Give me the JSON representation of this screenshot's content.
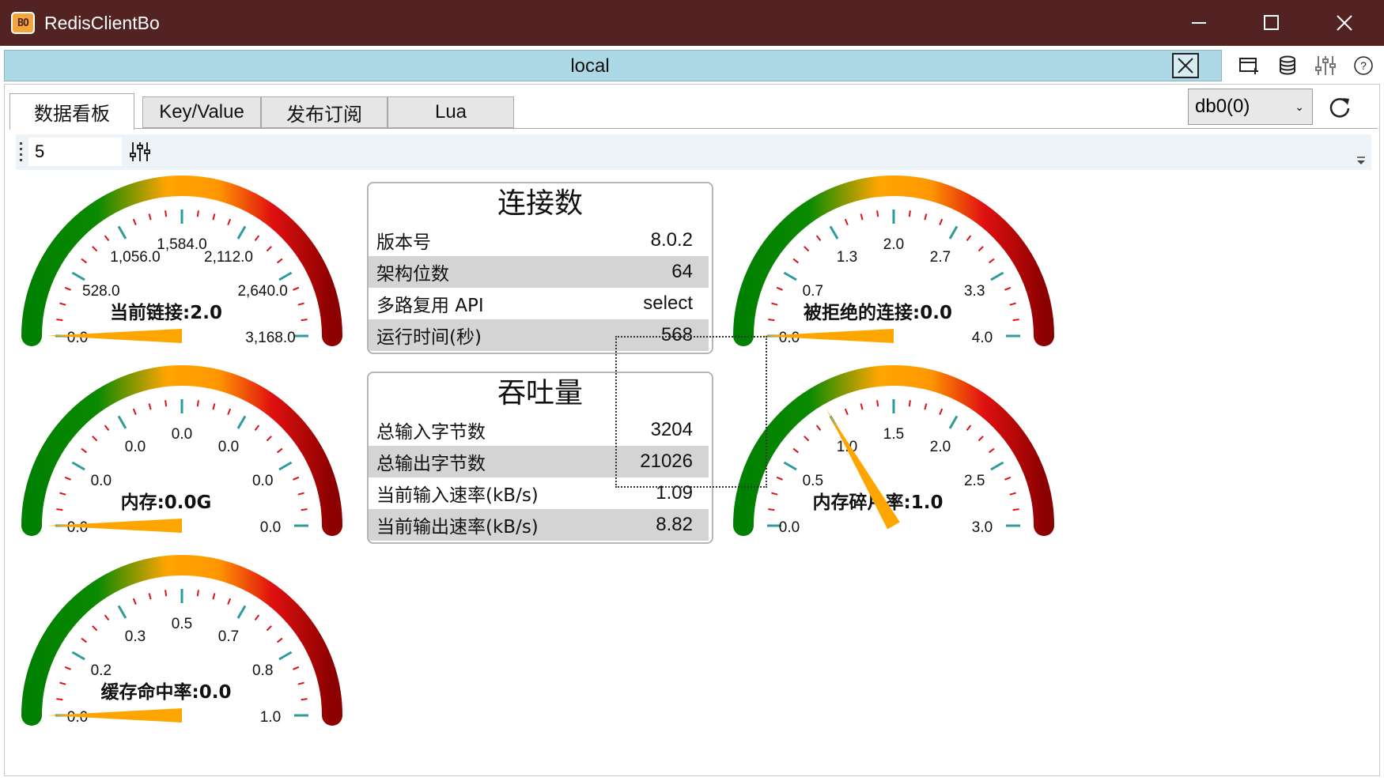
{
  "app": {
    "title": "RedisClientBo",
    "icon_text": "BO"
  },
  "connection": {
    "tab_title": "local"
  },
  "toolbar_icons": [
    "new-window-icon",
    "database-icon",
    "sliders-icon",
    "help-icon"
  ],
  "tabs": [
    {
      "label": "数据看板",
      "active": true
    },
    {
      "label": "Key/Value",
      "active": false
    },
    {
      "label": "发布订阅",
      "active": false
    },
    {
      "label": "Lua",
      "active": false
    }
  ],
  "db_select": {
    "value": "db0(0)"
  },
  "refresh_interval": "5",
  "gauges": [
    {
      "id": "connections",
      "label": "当前链接:2.0",
      "value": 2.0,
      "min": 0,
      "max": 3168,
      "ticks": [
        "0.0",
        "528.0",
        "1,056.0",
        "1,584.0",
        "2,112.0",
        "2,640.0",
        "3,168.0"
      ]
    },
    {
      "id": "memory",
      "label": "内存:0.0G",
      "value": 0,
      "min": 0,
      "max": 1,
      "ticks": [
        "0.0",
        "0.0",
        "0.0",
        "0.0",
        "0.0",
        "0.0",
        "0.0"
      ]
    },
    {
      "id": "hit-rate",
      "label": "缓存命中率:0.0",
      "value": 0,
      "min": 0,
      "max": 1,
      "ticks": [
        "0.0",
        "0.2",
        "0.3",
        "0.5",
        "0.7",
        "0.8",
        "1.0"
      ]
    },
    {
      "id": "rejected",
      "label": "被拒绝的连接:0.0",
      "value": 0,
      "min": 0,
      "max": 4,
      "ticks": [
        "0.0",
        "0.7",
        "1.3",
        "2.0",
        "2.7",
        "3.3",
        "4.0"
      ]
    },
    {
      "id": "fragmentation",
      "label": "内存碎片率:1.0",
      "value": 1.0,
      "min": 0,
      "max": 3,
      "ticks": [
        "0.0",
        "0.5",
        "1.0",
        "1.5",
        "2.0",
        "2.5",
        "3.0"
      ]
    }
  ],
  "connections_panel": {
    "title": "连接数",
    "rows": [
      {
        "label": "版本号",
        "value": "8.0.2"
      },
      {
        "label": "架构位数",
        "value": "64"
      },
      {
        "label": "多路复用 API",
        "value": "select"
      },
      {
        "label": "运行时间(秒)",
        "value": "568"
      }
    ]
  },
  "throughput_panel": {
    "title": "吞吐量",
    "rows": [
      {
        "label": "总输入字节数",
        "value": "3204"
      },
      {
        "label": "总输出字节数",
        "value": "21026"
      },
      {
        "label": "当前输入速率(kB/s)",
        "value": "1.09"
      },
      {
        "label": "当前输出速率(kB/s)",
        "value": "8.82"
      }
    ]
  },
  "colors": {
    "titlebar": "#532222",
    "conn_tab": "#add8e6",
    "needle": "#ffa500",
    "tick": "#2e9a9a",
    "minor_tick": "#e01010"
  }
}
